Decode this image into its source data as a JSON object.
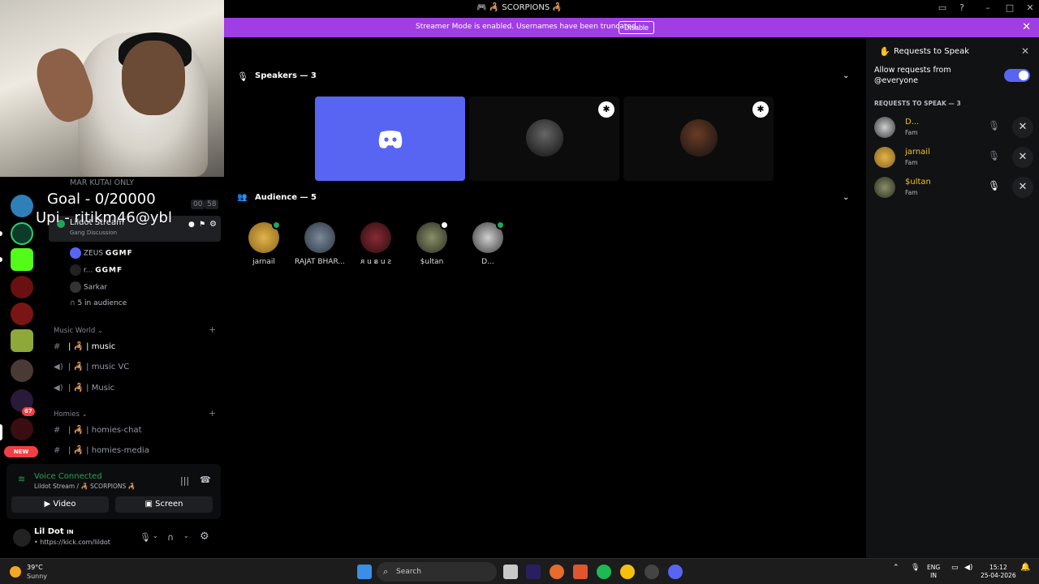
{
  "window": {
    "title": "🎮 🦂 SCORPIONS 🦂",
    "inbox_icon": "inbox-icon",
    "help_icon": "help-icon"
  },
  "banner": {
    "message": "Streamer Mode is enabled. Usernames have been truncated.",
    "disable_label": "Disable",
    "close": "✕"
  },
  "overlay": {
    "goal": "Goal - 0/20000",
    "upi": "Upi - ritikm46@ybl"
  },
  "guilds": {
    "new_label": "NEW",
    "unread_count": "67"
  },
  "channels": {
    "mar_kutai": "MAR KUTAI ONLY",
    "counter_left": "00",
    "counter_right": "58",
    "stage_name": "Lildot Stream",
    "stage_topic": "Gang Discussion",
    "members": [
      {
        "name": "ZEUS",
        "tag": "GGMF"
      },
      {
        "name": "r...",
        "tag": "GGMF"
      },
      {
        "name": "Sarkar",
        "tag": ""
      }
    ],
    "audience_count": "5 in audience",
    "category_music": "Music World",
    "music_channels": [
      "| 🦂 | music",
      "| 🦂 | music VC",
      "| 🦂 | Music"
    ],
    "category_homies": "Homies",
    "homies_channels": [
      "| 🦂 | homies-chat",
      "| 🦂 | homies-media"
    ]
  },
  "voice": {
    "status": "Voice Connected",
    "location": "Lildot Stream / 🦂 SCORPIONS 🦂",
    "video_label": "Video",
    "screen_label": "Screen"
  },
  "user": {
    "name": "Lil Dot",
    "name_suffix": "IN",
    "status": "• https://kick.com/lildot"
  },
  "stage": {
    "speakers_title": "Speakers — 3",
    "audience_title": "Audience — 5",
    "audience": [
      {
        "name": "jarnail",
        "color": "#b8892a"
      },
      {
        "name": "RAJAT BHAR...",
        "color": "#3a4a5a"
      },
      {
        "name": "ᴙ u ᴃ u ƨ",
        "color": "#5a1d25"
      },
      {
        "name": "$ultan",
        "color": "#555a45"
      },
      {
        "name": "D...",
        "color": "#8d8d8d"
      }
    ]
  },
  "panel": {
    "title": "Requests to Speak",
    "allow_label": "Allow requests from @everyone",
    "allow_enabled": true,
    "requests_header": "REQUESTS TO SPEAK — 3",
    "requests": [
      {
        "name": "D...",
        "role": "Fam",
        "color": "#8d8d8d"
      },
      {
        "name": "jarnail",
        "role": "Fam",
        "color": "#b8892a"
      },
      {
        "name": "$ultan",
        "role": "Fam",
        "color": "#555a45"
      }
    ]
  },
  "taskbar": {
    "temperature": "39°C",
    "condition": "Sunny",
    "search_placeholder": "Search",
    "lang_line1": "ENG",
    "lang_line2": "IN",
    "time": "15:12",
    "date": "25-04-2026"
  },
  "colors": {
    "accent": "#5865f2",
    "banner": "#a13de5",
    "voice_green": "#23a55a"
  }
}
